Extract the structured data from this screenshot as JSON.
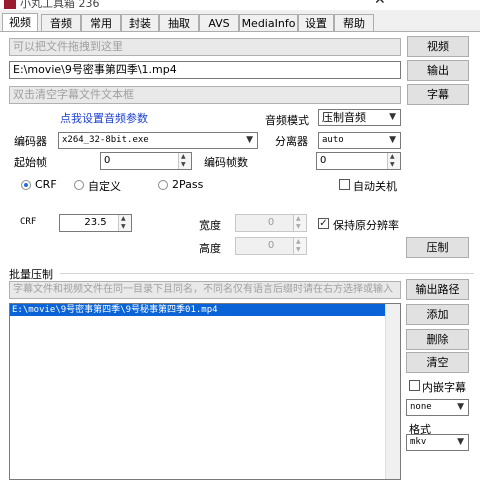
{
  "window": {
    "title": "小丸工具箱 236",
    "close_glyph": "✕"
  },
  "tabs": [
    {
      "label": "视频"
    },
    {
      "label": "音频"
    },
    {
      "label": "常用"
    },
    {
      "label": "封装"
    },
    {
      "label": "抽取"
    },
    {
      "label": "AVS"
    },
    {
      "label": "MediaInfo"
    },
    {
      "label": "设置"
    },
    {
      "label": "帮助"
    }
  ],
  "video": {
    "video_input_placeholder": "可以把文件拖拽到这里",
    "video_button": "视频",
    "output_path": "E:\\movie\\9号密事第四季\\1.mp4",
    "output_button": "输出",
    "subtitle_placeholder": "双击清空字幕文件文本框",
    "subtitle_button": "字幕",
    "audio_settings_link": "点我设置音频参数",
    "audio_mode_label": "音频模式",
    "audio_mode_value": "压制音频",
    "encoder_label": "编码器",
    "encoder_value": "x264_32-8bit.exe",
    "splitter_label": "分离器",
    "splitter_value": "auto",
    "start_frame_label": "起始帧",
    "start_frame_value": "0",
    "encode_frames_label": "编码帧数",
    "encode_frames_value": "0",
    "rate_modes": [
      {
        "label": "CRF",
        "selected": true
      },
      {
        "label": "自定义",
        "selected": false
      },
      {
        "label": "2Pass",
        "selected": false
      }
    ],
    "shutdown_label": "自动关机",
    "shutdown_checked": false,
    "crf_label": "CRF",
    "crf_value": "23.5",
    "width_label": "宽度",
    "width_value": "0",
    "height_label": "高度",
    "height_value": "0",
    "keep_resolution_label": "保持原分辨率",
    "keep_resolution_checked": true,
    "encode_button": "压制",
    "check_glyph": "✓"
  },
  "batch": {
    "section_label": "批量压制",
    "hint": "字幕文件和视频文件在同一目录下且同名，不同名仅有语言后缀时请在右方选择或输入",
    "output_path_button": "输出路径",
    "files": [
      "E:\\movie\\9号密事第四季\\9号秘事第四季01.mp4"
    ],
    "add_button": "添加",
    "delete_button": "删除",
    "clear_button": "清空",
    "embed_subtitle_label": "内嵌字幕",
    "embed_subtitle_checked": false,
    "subtitle_select_value": "none",
    "format_label": "格式",
    "format_value": "mkv"
  },
  "colors": {
    "selection": "#0a64d8",
    "link": "#1a3fd0",
    "radio_dot": "#1e6fd9",
    "app_icon": "#9a1b2e"
  }
}
